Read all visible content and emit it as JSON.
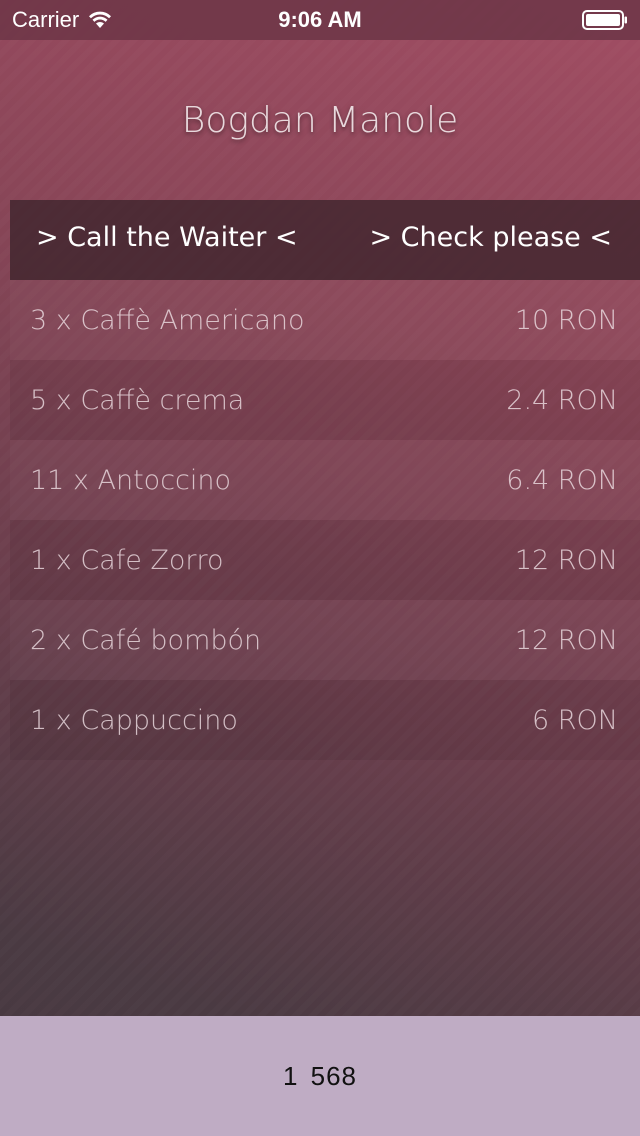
{
  "status_bar": {
    "carrier": "Carrier",
    "time": "9:06 AM",
    "wifi_icon": "wifi-icon",
    "battery_icon": "battery-icon"
  },
  "header": {
    "title": "Bogdan Manole"
  },
  "actions": {
    "call_waiter": "> Call the Waiter <",
    "check_please": "> Check please <"
  },
  "orders": [
    {
      "item": "3 x Caffè Americano",
      "price": "10 RON"
    },
    {
      "item": "5 x Caffè crema",
      "price": "2.4 RON"
    },
    {
      "item": "11 x Antoccino",
      "price": "6.4 RON"
    },
    {
      "item": "1 x Cafe Zorro",
      "price": "12 RON"
    },
    {
      "item": "2 x Café bombón",
      "price": "12 RON"
    },
    {
      "item": "1 x Cappuccino",
      "price": "6 RON"
    }
  ],
  "footer": {
    "value": "1 568"
  },
  "colors": {
    "status_bar": "#703749",
    "background_top": "#a14d63",
    "background_bottom": "#463840",
    "action_bar": "#3c242c",
    "footer": "#bfacc4"
  }
}
